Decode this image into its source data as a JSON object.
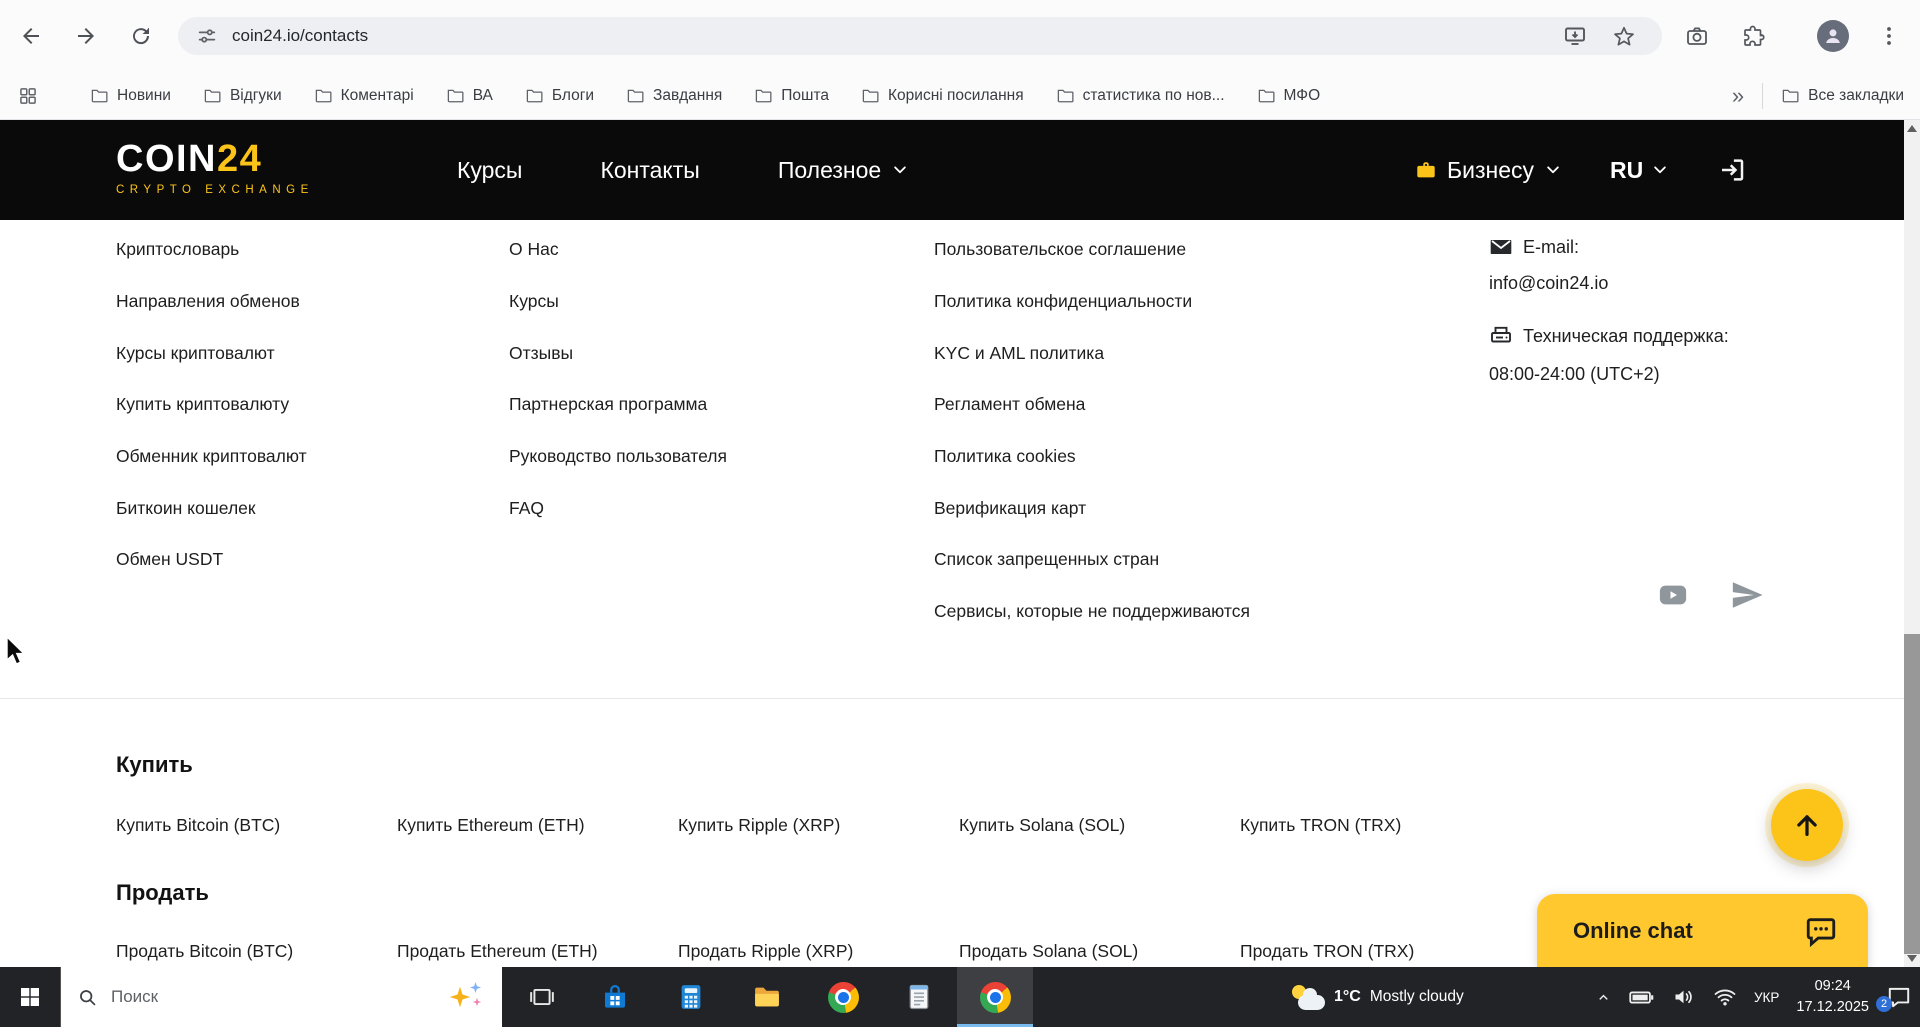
{
  "colors": {
    "accent_yellow": "#fcc419",
    "chat_yellow": "#ffc82e",
    "site_header_bg": "#0a0a0b",
    "taskbar_bg": "#222326"
  },
  "browser": {
    "url": "coin24.io/contacts",
    "bookmarks": [
      "Новини",
      "Відгуки",
      "Коментарі",
      "ВА",
      "Блоги",
      "Завдання",
      "Пошта",
      "Корисні посилання",
      "статистика по нов...",
      "МФО"
    ],
    "overflow_chevron": "»",
    "all_bookmarks": "Все закладки"
  },
  "site_header": {
    "logo": {
      "name": "COIN",
      "number": "24",
      "subtitle": "CRYPTO EXCHANGE"
    },
    "nav": [
      "Курсы",
      "Контакты",
      "Полезное"
    ],
    "business": "Бизнесу",
    "language": "RU"
  },
  "footer": {
    "col1": [
      "Криптословарь",
      "Направления обменов",
      "Курсы криптовалют",
      "Купить криптовалюту",
      "Обменник криптовалют",
      "Биткоин кошелек",
      "Обмен USDT"
    ],
    "col2": [
      "О Нас",
      "Курсы",
      "Отзывы",
      "Партнерская программа",
      "Руководство пользователя",
      "FAQ"
    ],
    "col3": [
      "Пользовательское соглашение",
      "Политика конфиденциальности",
      "KYC и AML политика",
      "Регламент обмена",
      "Политика cookies",
      "Верификация карт",
      "Список запрещенных стран",
      "Сервисы, которые не поддерживаются"
    ],
    "contacts": {
      "email_label": "E-mail:",
      "email": "info@coin24.io",
      "support_label": "Техническая поддержка:",
      "support_hours": "08:00-24:00 (UTC+2)"
    }
  },
  "seo": {
    "buy_title": "Купить",
    "buy_links": [
      "Купить Bitcoin (BTC)",
      "Купить Ethereum (ETH)",
      "Купить Ripple (XRP)",
      "Купить Solana (SOL)",
      "Купить TRON (TRX)"
    ],
    "sell_title": "Продать",
    "sell_links": [
      "Продать Bitcoin (BTC)",
      "Продать Ethereum (ETH)",
      "Продать Ripple (XRP)",
      "Продать Solana (SOL)",
      "Продать TRON (TRX)"
    ]
  },
  "chat": {
    "label": "Online chat"
  },
  "taskbar": {
    "search_text": "Поиск",
    "weather": {
      "temperature": "1°C",
      "condition": "Mostly cloudy"
    },
    "language": "УКР",
    "time": "09:24",
    "date": "17.12.2025",
    "notification_count": "2"
  },
  "icon_names": [
    "back-icon",
    "forward-icon",
    "reload-icon",
    "site-info-icon",
    "install-icon",
    "bookmark-star-icon",
    "camera-icon",
    "extensions-icon",
    "profile-avatar",
    "menu-icon",
    "apps-grid-icon",
    "folder-icon",
    "chevron-down-icon",
    "briefcase-icon",
    "logout-icon",
    "email-icon",
    "support-icon",
    "youtube-icon",
    "telegram-icon",
    "arrow-up-icon",
    "chat-bubble-icon",
    "windows-start-icon",
    "search-icon",
    "sparkle-icon",
    "task-view-icon",
    "store-icon",
    "calculator-icon",
    "file-explorer-icon",
    "chrome-icon",
    "notepad-icon",
    "weather-icon",
    "chevron-up-icon",
    "battery-icon",
    "volume-icon",
    "network-icon",
    "notification-icon"
  ]
}
